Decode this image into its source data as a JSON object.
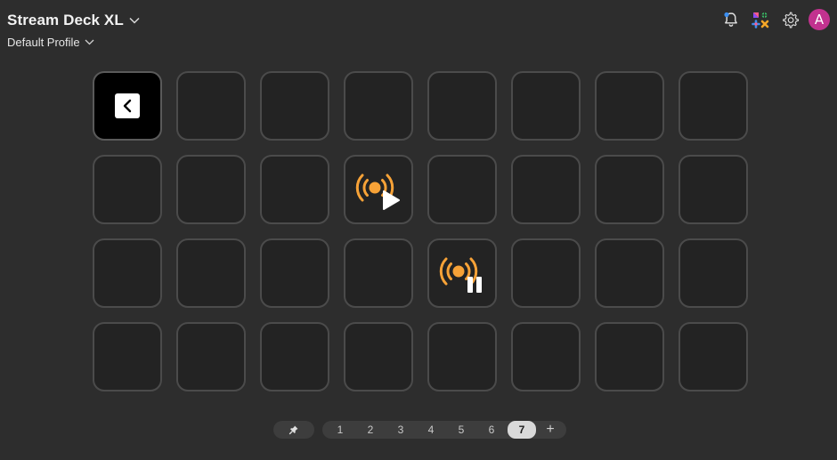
{
  "header": {
    "device_title": "Stream Deck XL",
    "profile_name": "Default Profile"
  },
  "toolbar": {
    "icons": [
      "notification-bell-icon",
      "marketplace-icon",
      "settings-gear-icon"
    ],
    "avatar_letter": "A",
    "avatar_color": "#c2328f"
  },
  "grid": {
    "rows": 4,
    "columns": 8,
    "keys": [
      {
        "row": 1,
        "col": 1,
        "action": "back",
        "icon": "back-chevron-icon"
      },
      {
        "row": 2,
        "col": 4,
        "action": "broadcast-play",
        "icon": "broadcast-play-icon"
      },
      {
        "row": 3,
        "col": 5,
        "action": "broadcast-pause",
        "icon": "broadcast-pause-icon"
      }
    ],
    "accent_color": "#f7a237"
  },
  "pager": {
    "pages": [
      "1",
      "2",
      "3",
      "4",
      "5",
      "6",
      "7"
    ],
    "active_page": "7",
    "add_label": "+"
  }
}
